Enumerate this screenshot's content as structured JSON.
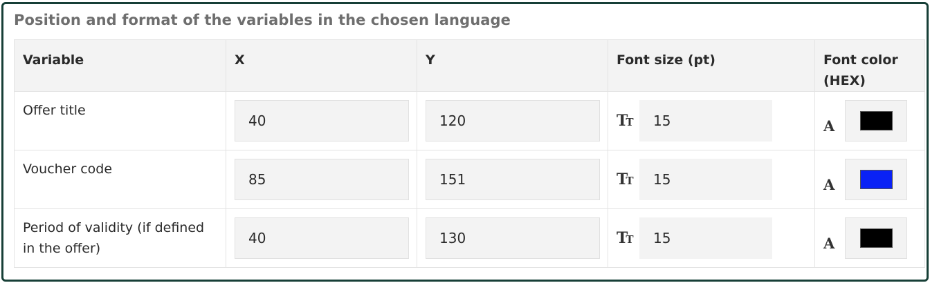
{
  "panel": {
    "title": "Position and format of the variables in the chosen language"
  },
  "table": {
    "headers": {
      "variable": "Variable",
      "x": "X",
      "y": "Y",
      "font_size": "Font size (pt)",
      "font_color": "Font color (HEX)"
    },
    "rows": [
      {
        "variable": "Offer title",
        "x": "40",
        "y": "120",
        "font_size": "15",
        "font_color": "#000000"
      },
      {
        "variable": "Voucher code",
        "x": "85",
        "y": "151",
        "font_size": "15",
        "font_color": "#0a22f5"
      },
      {
        "variable": "Period of validity (if defined in the offer)",
        "x": "40",
        "y": "130",
        "font_size": "15",
        "font_color": "#000000"
      }
    ]
  },
  "icons": {
    "font_size": "text-size-icon",
    "font_color": "font-color-icon"
  },
  "colors": {
    "frame_border": "#173f37",
    "header_bg": "#f3f3f3",
    "title_text": "#6e6e6e"
  }
}
